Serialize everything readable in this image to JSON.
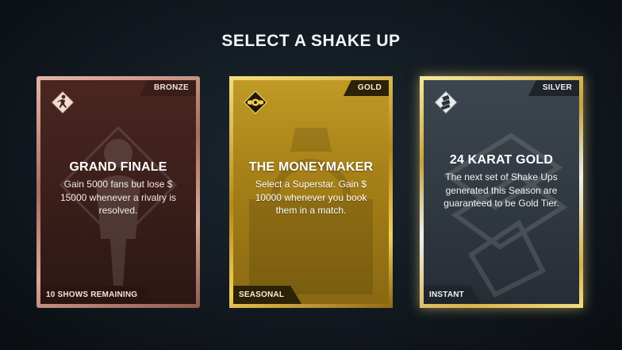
{
  "screen": {
    "title": "SELECT A SHAKE UP"
  },
  "cards": [
    {
      "tier": "BRONZE",
      "name": "GRAND FINALE",
      "description": "Gain 5000 fans but lose $ 15000 whenever a rivalry is resolved.",
      "footer": "10 SHOWS REMAINING",
      "icon": "running-figure-icon",
      "accent": "#b98474"
    },
    {
      "tier": "GOLD",
      "name": "THE MONEYMAKER",
      "description": "Select a Superstar. Gain $ 10000 whenever you book them in a match.",
      "footer": "SEASONAL",
      "icon": "championship-belt-icon",
      "accent": "#d4ad35"
    },
    {
      "tier": "SILVER",
      "name": "24 KARAT GOLD",
      "description": "The next set of Shake Ups generated this Season are guaranteed to be Gold Tier.",
      "footer": "INSTANT",
      "icon": "gold-bars-icon",
      "accent": "#c9ced2"
    }
  ]
}
